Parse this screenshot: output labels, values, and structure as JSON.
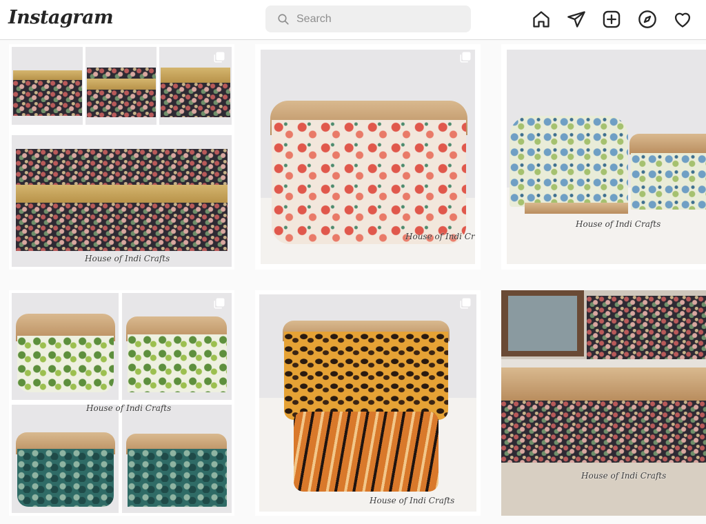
{
  "header": {
    "logo": "Instagram",
    "search": {
      "placeholder": "Search",
      "value": ""
    },
    "nav_icons": [
      "home-icon",
      "direct-message-icon",
      "new-post-icon",
      "explore-icon",
      "activity-heart-icon"
    ]
  },
  "grid": {
    "posts": [
      {
        "id": "post-1",
        "multi": true,
        "watermark": "House of Indi Crafts"
      },
      {
        "id": "post-2",
        "multi": true,
        "watermark": "House of Indi Crafts"
      },
      {
        "id": "post-3",
        "multi": false,
        "watermark": "House of Indi Crafts"
      },
      {
        "id": "post-4",
        "multi": true,
        "watermark": "House of Indi Crafts"
      },
      {
        "id": "post-5",
        "multi": true,
        "watermark": "House of Indi Crafts"
      },
      {
        "id": "post-6",
        "multi": false,
        "watermark": "House of Indi Crafts"
      }
    ]
  },
  "colors": {
    "background": "#fafafa",
    "search_bg": "#efefef",
    "icon": "#262626",
    "border": "#dbdbdb"
  }
}
